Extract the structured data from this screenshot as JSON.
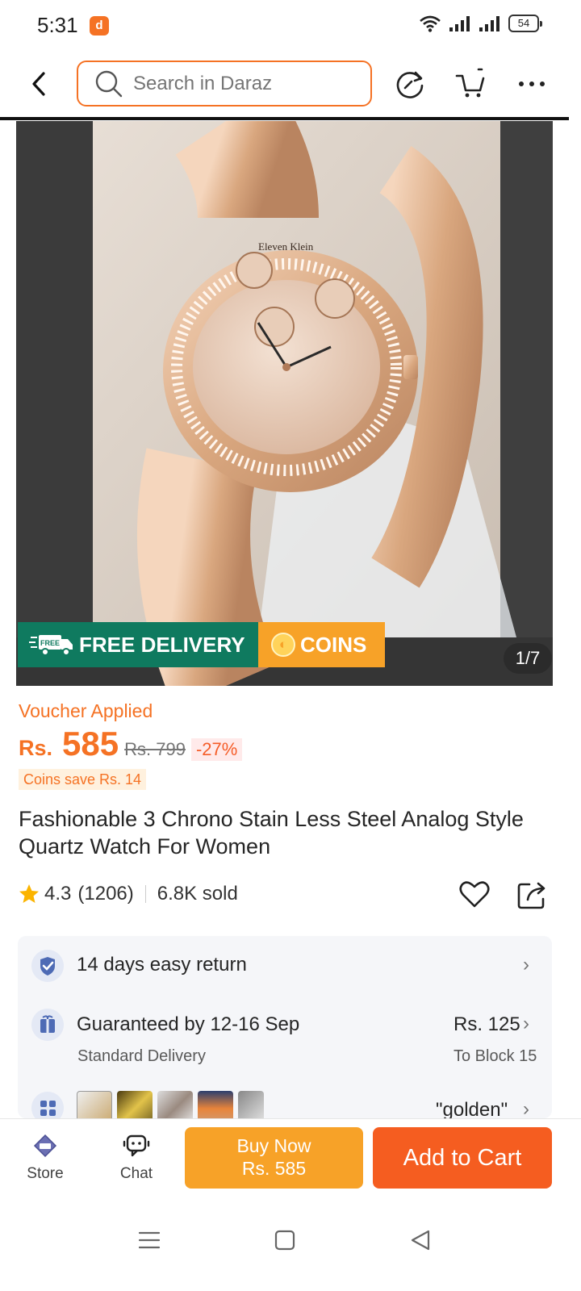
{
  "status_bar": {
    "time": "5:31",
    "battery": "54"
  },
  "search": {
    "placeholder": "Search in Daraz"
  },
  "product": {
    "image_counter": "1/7",
    "banner_free_delivery": "FREE DELIVERY",
    "banner_free_tag": "FREE",
    "banner_coins": "COINS",
    "image_logo_text": "Eleven Klein",
    "voucher_label": "Voucher Applied",
    "price_currency": "Rs.",
    "price": "585",
    "old_price": "Rs. 799",
    "discount": "-27%",
    "coins_save": "Coins save Rs. 14",
    "title": "Fashionable 3 Chrono Stain Less Steel Analog Style Quartz Watch For Women",
    "rating": "4.3",
    "rating_count": "(1206)",
    "sold": "6.8K sold"
  },
  "services": {
    "return_label": "14 days easy return",
    "delivery_label": "Guaranteed by 12-16 Sep",
    "delivery_type": "Standard Delivery",
    "delivery_fee": "Rs. 125",
    "delivery_location": "To Block 15",
    "variant_value": "\"golden\""
  },
  "bottom_bar": {
    "store_label": "Store",
    "chat_label": "Chat",
    "buy_now_label": "Buy Now",
    "buy_now_price": "Rs. 585",
    "add_to_cart_label": "Add to Cart"
  },
  "colors": {
    "accent": "#f57224",
    "buy_now": "#f7a228",
    "add_to_cart": "#f55d20",
    "free_delivery": "#0f7a5f"
  },
  "icons": [
    "back-arrow-icon",
    "search-icon",
    "refresh-icon",
    "cart-icon",
    "more-icon",
    "star-icon",
    "heart-icon",
    "share-icon",
    "shield-check-icon",
    "gift-box-icon",
    "variant-grid-icon",
    "store-icon",
    "chat-icon",
    "menu-icon",
    "home-icon",
    "back-triangle-icon"
  ]
}
